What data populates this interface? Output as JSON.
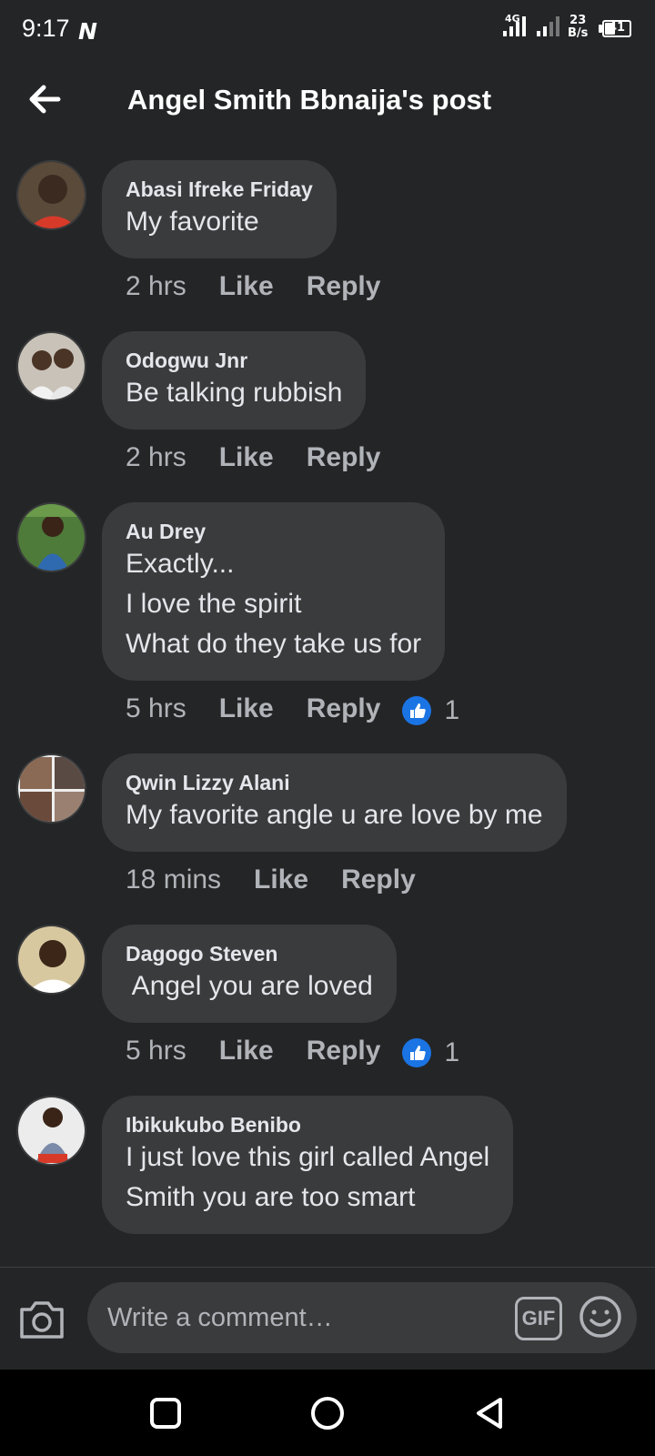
{
  "status_bar": {
    "time": "9:17",
    "network": "4G",
    "speed_value": "23",
    "speed_unit": "B/s",
    "battery": "41"
  },
  "header": {
    "title": "Angel Smith Bbnaija's post"
  },
  "comments": [
    {
      "author": "Abasi Ifreke Friday",
      "text": "My favorite",
      "time": "2 hrs",
      "like": "Like",
      "reply": "Reply",
      "reactions": ""
    },
    {
      "author": "Odogwu Jnr",
      "text": "Be talking rubbish",
      "time": "2 hrs",
      "like": "Like",
      "reply": "Reply",
      "reactions": ""
    },
    {
      "author": "Au Drey",
      "text": "Exactly...\nI love the spirit\nWhat do they take us for",
      "time": "5 hrs",
      "like": "Like",
      "reply": "Reply",
      "reactions": "1"
    },
    {
      "author": "Qwin Lizzy Alani",
      "text": "My favorite angle u are love by me",
      "time": "18 mins",
      "like": "Like",
      "reply": "Reply",
      "reactions": ""
    },
    {
      "author": "Dagogo Steven",
      "text": " Angel you are loved",
      "time": "5 hrs",
      "like": "Like",
      "reply": "Reply",
      "reactions": "1"
    },
    {
      "author": "Ibikukubo Benibo",
      "text": "I just love this girl called Angel\nSmith you are too smart",
      "time": "",
      "like": "",
      "reply": "",
      "reactions": ""
    }
  ],
  "composer": {
    "placeholder": "Write a comment…",
    "gif_label": "GIF"
  },
  "colors": {
    "background": "#242526",
    "bubble": "#3a3b3c",
    "text": "#e4e6eb",
    "muted": "#b0b3b8",
    "like_blue": "#1b74e4"
  },
  "icons": [
    "back-arrow-icon",
    "camera-icon",
    "gif-icon",
    "emoji-icon",
    "like-reaction-icon",
    "nav-square-icon",
    "nav-circle-icon",
    "nav-triangle-icon"
  ]
}
